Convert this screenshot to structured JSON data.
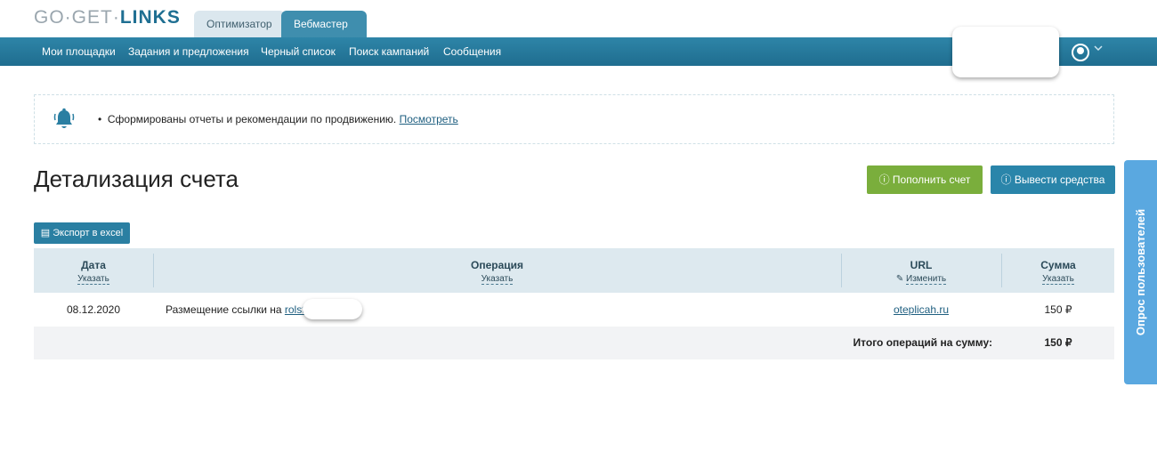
{
  "logo": {
    "part1": "GO",
    "dot1": "·",
    "part2": "GET",
    "dot2": "·",
    "part3": "LINKS"
  },
  "tabs": [
    {
      "label": "Оптимизатор"
    },
    {
      "label": "Вебмастер"
    }
  ],
  "nav": {
    "items": [
      "Мои площадки",
      "Задания и предложения",
      "Черный список",
      "Поиск кампаний",
      "Сообщения"
    ]
  },
  "notice": {
    "text": "Сформированы отчеты и рекомендации по продвижению.",
    "link": "Посмотреть"
  },
  "page": {
    "title": "Детализация счета"
  },
  "buttons": {
    "topup": "Пополнить счет",
    "withdraw": "Вывести средства",
    "export": "Экспорт в excel"
  },
  "table": {
    "headers": {
      "date": "Дата",
      "operation": "Операция",
      "url": "URL",
      "sum": "Сумма",
      "specify": "Указать",
      "edit": "Изменить"
    },
    "rows": [
      {
        "date": "08.12.2020",
        "operation_prefix": "Размещение ссылки на",
        "operation_link": "rolst",
        "url": "oteplicah.ru",
        "sum": "150 ₽"
      }
    ],
    "total": {
      "label": "Итого операций на сумму:",
      "value": "150 ₽"
    }
  },
  "survey": {
    "label": "Опрос пользователей"
  },
  "colors": {
    "navbar": "#1f6d8f",
    "green_button": "#7aae3c",
    "blue_button": "#2a85aa",
    "survey": "#5aa8e0"
  }
}
